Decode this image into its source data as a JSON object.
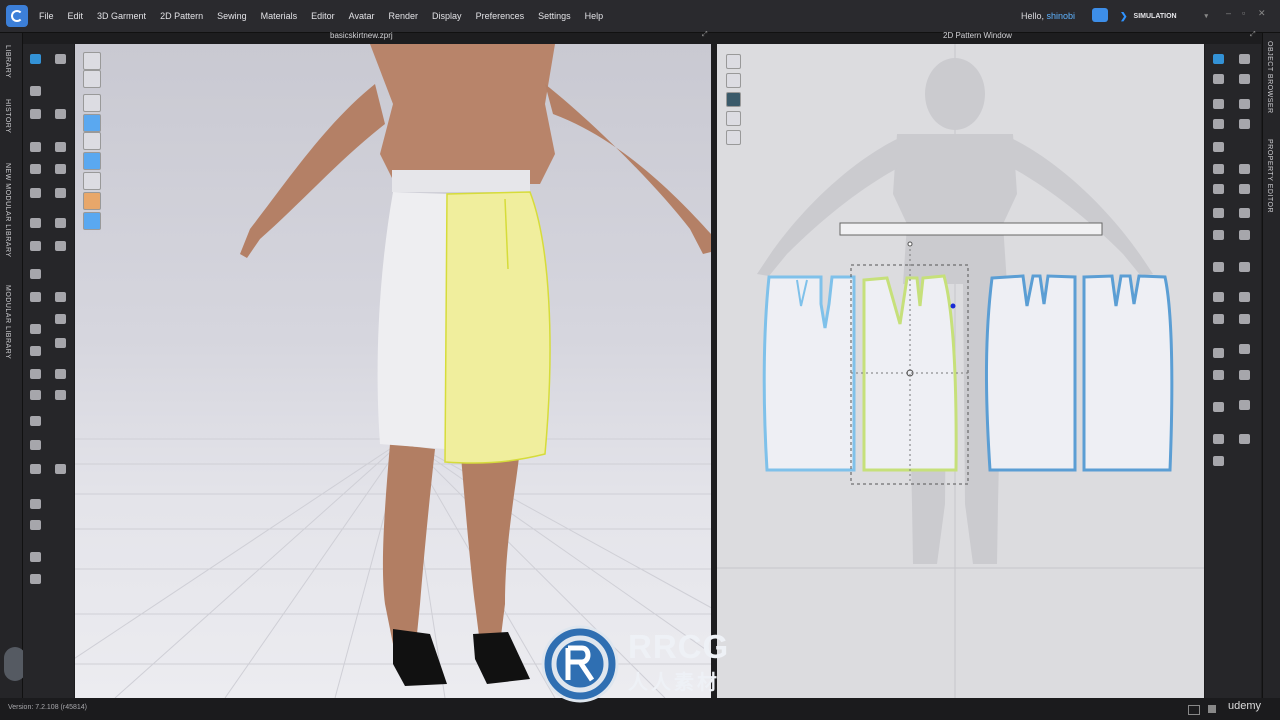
{
  "app": {
    "menu": [
      "File",
      "Edit",
      "3D Garment",
      "2D Pattern",
      "Sewing",
      "Materials",
      "Editor",
      "Avatar",
      "Render",
      "Display",
      "Preferences",
      "Settings",
      "Help"
    ],
    "hello_prefix": "Hello,",
    "username": "shinobi",
    "mode": "SIMULATION",
    "accent": "#2f93ff"
  },
  "side_tabs": {
    "left": [
      "LIBRARY",
      "HISTORY",
      "NEW MODULAR LIBRARY",
      "MODULAR LIBRARY"
    ],
    "right": [
      "OBJECT BROWSER",
      "PROPERTY EDITOR"
    ]
  },
  "viewports": {
    "view3d_title": "basicskirtnew.zprj",
    "view2d_title": "2D Pattern Window"
  },
  "status": {
    "version": "Version: 7.2.108 (r45814)"
  },
  "watermark": {
    "line1": "RRCG",
    "line2": "人人素材",
    "brand": "udemy"
  },
  "icons": {
    "left_toolbar": [
      "select-icon",
      "transform-icon",
      "edit-pattern-icon",
      "edit-point-icon",
      "edit-curvature-icon",
      "add-point-icon",
      "polygon-icon",
      "rectangle-icon",
      "circle-icon",
      "internal-polygon-icon",
      "dart-icon",
      "trace-icon",
      "segment-sewing-icon",
      "free-sewing-icon",
      "check-sewing-icon",
      "edit-texture-icon",
      "graphic-icon",
      "button-icon",
      "buttonhole-icon",
      "zipper-icon",
      "fold-icon",
      "pin-icon",
      "measure-icon",
      "tape-icon",
      "puckering-icon",
      "topstitch-icon",
      "smoothing-icon"
    ],
    "right_toolbar": [
      "select-icon",
      "transform-icon",
      "pattern-icon",
      "rectangle-icon",
      "circle-icon",
      "dart-icon",
      "sewing-icon",
      "text-icon",
      "grid-icon"
    ]
  }
}
